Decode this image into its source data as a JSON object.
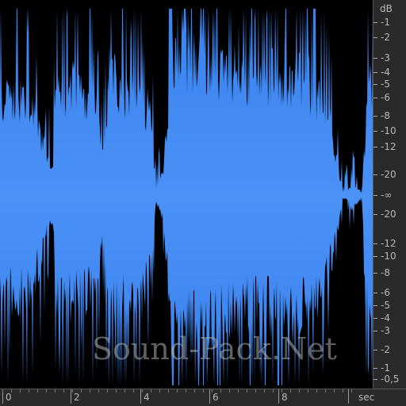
{
  "colors": {
    "background": "#000000",
    "waveform": "#3a86f2",
    "waveform_center": "#4f94f5",
    "panel": "#2a2a2a",
    "text": "#b8b8b8"
  },
  "db_scale": {
    "unit": "dB",
    "labels": [
      "-1",
      "-2",
      "-3",
      "-4",
      "-5",
      "-6",
      "-8",
      "-10",
      "-12",
      "-20",
      "-∞",
      "-20",
      "-12",
      "-10",
      "-8",
      "-6",
      "-5",
      "-4",
      "-3",
      "-2",
      "-1",
      "-0,5"
    ]
  },
  "time_ruler": {
    "unit": "sec",
    "labels": [
      "0",
      "2",
      "4",
      "6",
      "8"
    ]
  },
  "watermark": "Sound-Pack.Net"
}
